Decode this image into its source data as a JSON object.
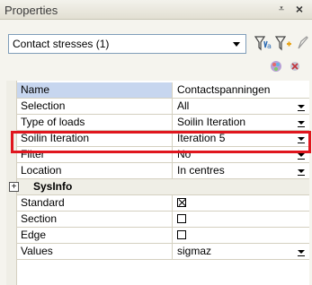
{
  "panel": {
    "title": "Properties",
    "pin_glyph": "⩡",
    "close_glyph": "×"
  },
  "selector": {
    "value": "Contact stresses (1)"
  },
  "toolbar": {
    "icons": [
      "filter-values-icon",
      "filter-add-icon",
      "pencil-icon"
    ],
    "small_icons": [
      "color-palette-icon",
      "clear-icon"
    ]
  },
  "properties": [
    {
      "name": "Name",
      "value": "Contactspanningen",
      "kind": "text",
      "selected": true
    },
    {
      "name": "Selection",
      "value": "All",
      "kind": "dropdown"
    },
    {
      "name": "Type of loads",
      "value": "Soilin Iteration",
      "kind": "dropdown"
    },
    {
      "name": "Soilin Iteration",
      "value": "Iteration 5",
      "kind": "dropdown",
      "highlighted": true
    },
    {
      "name": "Filter",
      "value": "No",
      "kind": "dropdown"
    },
    {
      "name": "Location",
      "value": "In centres",
      "kind": "dropdown"
    }
  ],
  "category": {
    "label": "SysInfo",
    "expander_glyph": "+"
  },
  "sysinfo": [
    {
      "name": "Standard",
      "checked": true,
      "kind": "checkbox"
    },
    {
      "name": "Section",
      "checked": false,
      "kind": "checkbox"
    },
    {
      "name": "Edge",
      "checked": false,
      "kind": "checkbox"
    },
    {
      "name": "Values",
      "value": "sigmaz",
      "kind": "dropdown"
    }
  ],
  "colors": {
    "highlight": "#e0161e",
    "selected_row": "#c7d6ef"
  }
}
